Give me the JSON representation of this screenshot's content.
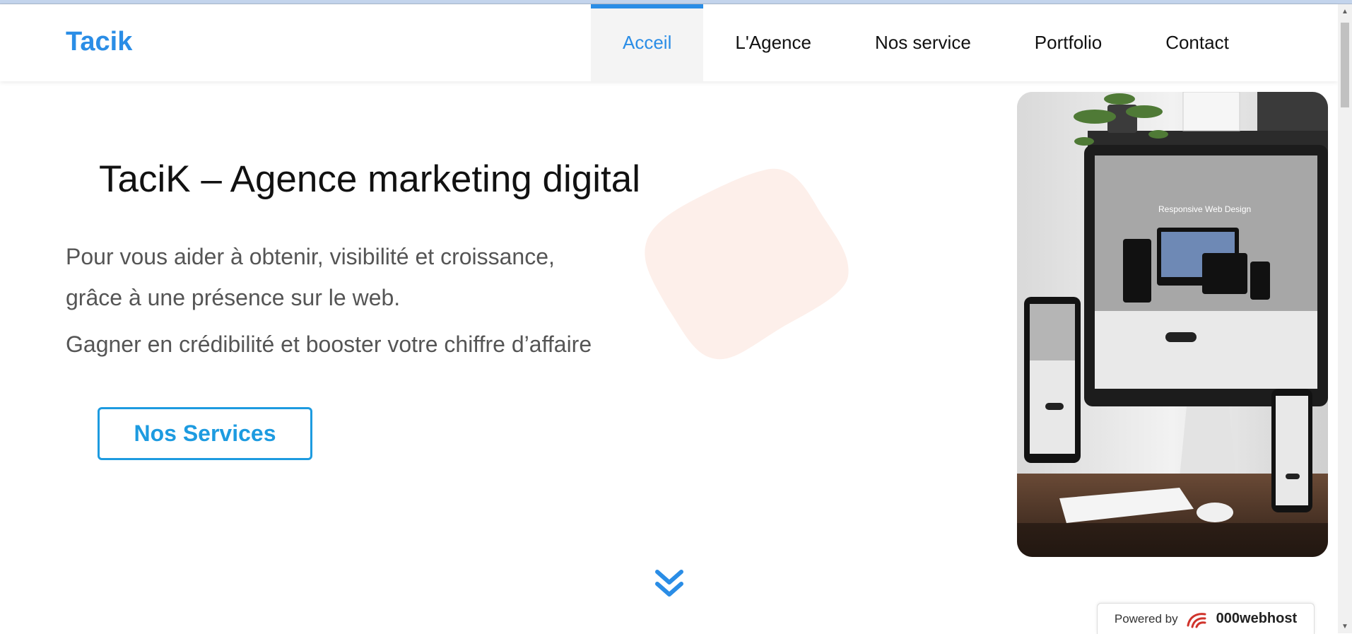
{
  "header": {
    "brand": "Tacik",
    "nav": [
      {
        "label": "Acceil",
        "active": true
      },
      {
        "label": "L'Agence",
        "active": false
      },
      {
        "label": "Nos service",
        "active": false
      },
      {
        "label": "Portfolio",
        "active": false
      },
      {
        "label": "Contact",
        "active": false
      }
    ]
  },
  "hero": {
    "title": "TaciK – Agence marketing digital",
    "paragraph1": "Pour vous aider à obtenir, visibilité et croissance, grâce à une présence sur le web.",
    "paragraph2": "Gagner en crédibilité et booster votre chiffre d’affaire",
    "cta_label": "Nos Services",
    "image_screen_text": "Responsive Web Design"
  },
  "badge": {
    "prefix": "Powered by",
    "brand": "000webhost"
  },
  "colors": {
    "accent": "#2a8de6",
    "cta": "#1d9be0",
    "blob": "#fdefea",
    "text": "#555555",
    "scroll_icon": "#2a8de6"
  },
  "icons": [
    "double-chevron-down-icon",
    "000webhost-logo-icon",
    "scroll-arrow-up-icon",
    "scroll-arrow-down-icon"
  ]
}
